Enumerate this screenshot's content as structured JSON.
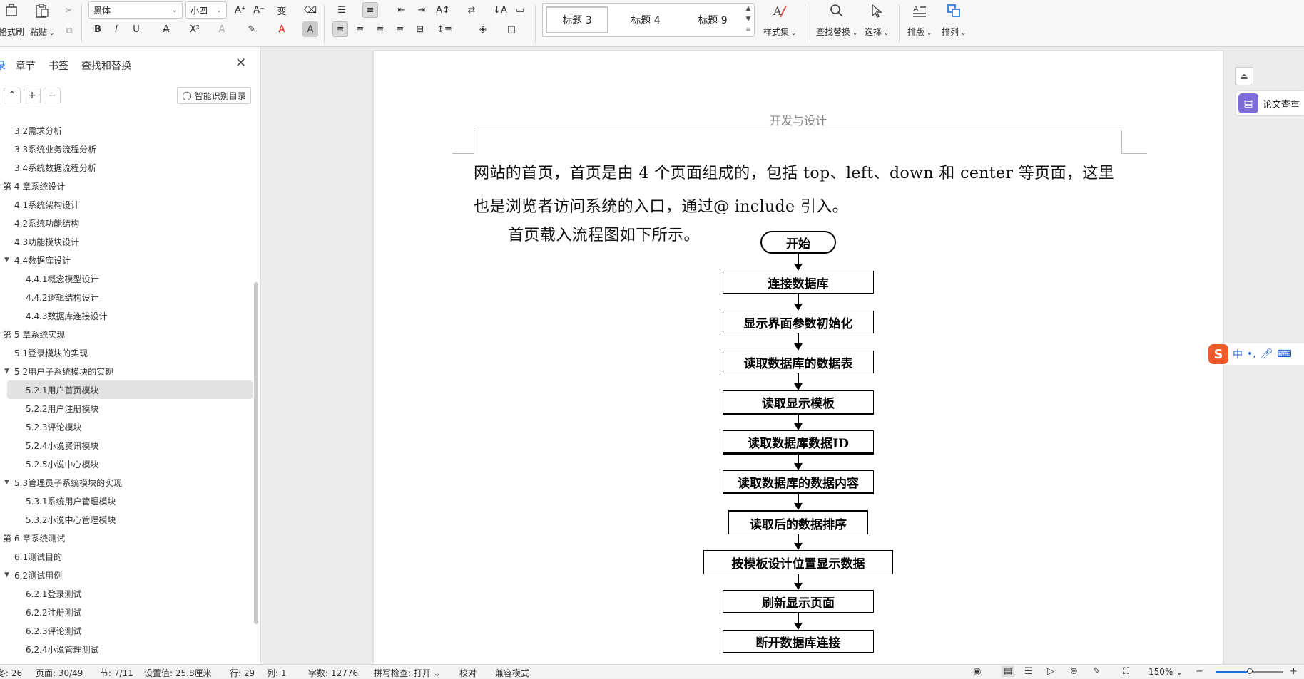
{
  "ribbon": {
    "format_painter_label": "格式刷",
    "paste_label": "粘贴",
    "font_name": "黑体",
    "font_size": "小四",
    "styles": [
      "标题 3",
      "标题 4",
      "标题 9"
    ],
    "style_set_label": "样式集",
    "find_replace_label": "查找替换",
    "select_label": "选择",
    "layout_label": "排版",
    "arrange_label": "排列"
  },
  "nav": {
    "tabs": [
      "录",
      "章节",
      "书签",
      "查找和替换"
    ],
    "smart_toc_label": "智能识别目录",
    "items": [
      {
        "label": "3.2需求分析",
        "level": 2
      },
      {
        "label": "3.3系统业务流程分析",
        "level": 2
      },
      {
        "label": "3.4系统数据流程分析",
        "level": 2
      },
      {
        "label": "第 4 章系统设计",
        "level": 1
      },
      {
        "label": "4.1系统架构设计",
        "level": 2
      },
      {
        "label": "4.2系统功能结构",
        "level": 2
      },
      {
        "label": "4.3功能模块设计",
        "level": 2
      },
      {
        "label": "4.4数据库设计",
        "level": 2,
        "expanded": true
      },
      {
        "label": "4.4.1概念模型设计",
        "level": 3
      },
      {
        "label": "4.4.2逻辑结构设计",
        "level": 3
      },
      {
        "label": "4.4.3数据库连接设计",
        "level": 3
      },
      {
        "label": "第 5 章系统实现",
        "level": 1
      },
      {
        "label": "5.1登录模块的实现",
        "level": 2
      },
      {
        "label": "5.2用户子系统模块的实现",
        "level": 2,
        "expanded": true
      },
      {
        "label": "5.2.1用户首页模块",
        "level": 3,
        "selected": true
      },
      {
        "label": "5.2.2用户注册模块",
        "level": 3
      },
      {
        "label": "5.2.3评论模块",
        "level": 3
      },
      {
        "label": "5.2.4小说资讯模块",
        "level": 3
      },
      {
        "label": "5.2.5小说中心模块",
        "level": 3
      },
      {
        "label": "5.3管理员子系统模块的实现",
        "level": 2,
        "expanded": true
      },
      {
        "label": "5.3.1系统用户管理模块",
        "level": 3
      },
      {
        "label": "5.3.2小说中心管理模块",
        "level": 3
      },
      {
        "label": "第 6 章系统测试",
        "level": 1
      },
      {
        "label": "6.1测试目的",
        "level": 2
      },
      {
        "label": "6.2测试用例",
        "level": 2,
        "expanded": true
      },
      {
        "label": "6.2.1登录测试",
        "level": 3
      },
      {
        "label": "6.2.2注册测试",
        "level": 3
      },
      {
        "label": "6.2.3评论测试",
        "level": 3
      },
      {
        "label": "6.2.4小说管理测试",
        "level": 3
      }
    ]
  },
  "document": {
    "header": "开发与设计",
    "para1": "网站的首页，首页是由 4 个页面组成的，包括 top、left、down 和 center 等页面，这里也是浏览者访问系统的入口，通过@ include 引入。",
    "para2": "首页载入流程图如下所示。",
    "flowchart": [
      "开始",
      "连接数据库",
      "显示界面参数初始化",
      "读取数据库的数据表",
      "读取显示模板",
      "读取数据库数据ID",
      "读取数据库的数据内容",
      "读取后的数据排序",
      "按模板设计位置显示数据",
      "刷新显示页面",
      "断开数据库连接"
    ]
  },
  "side": {
    "paper_check_label": "论文查重",
    "ime_chinese": "中"
  },
  "status": {
    "section_lines": "冬: 26",
    "page": "页面: 30/49",
    "section": "节: 7/11",
    "setting": "设置值: 25.8厘米",
    "row": "行: 29",
    "col": "列: 1",
    "words": "字数: 12776",
    "spellcheck": "拼写检查: 打开",
    "proofread": "校对",
    "compat": "兼容模式",
    "zoom": "150%",
    "zoom_fraction": 0.5
  }
}
